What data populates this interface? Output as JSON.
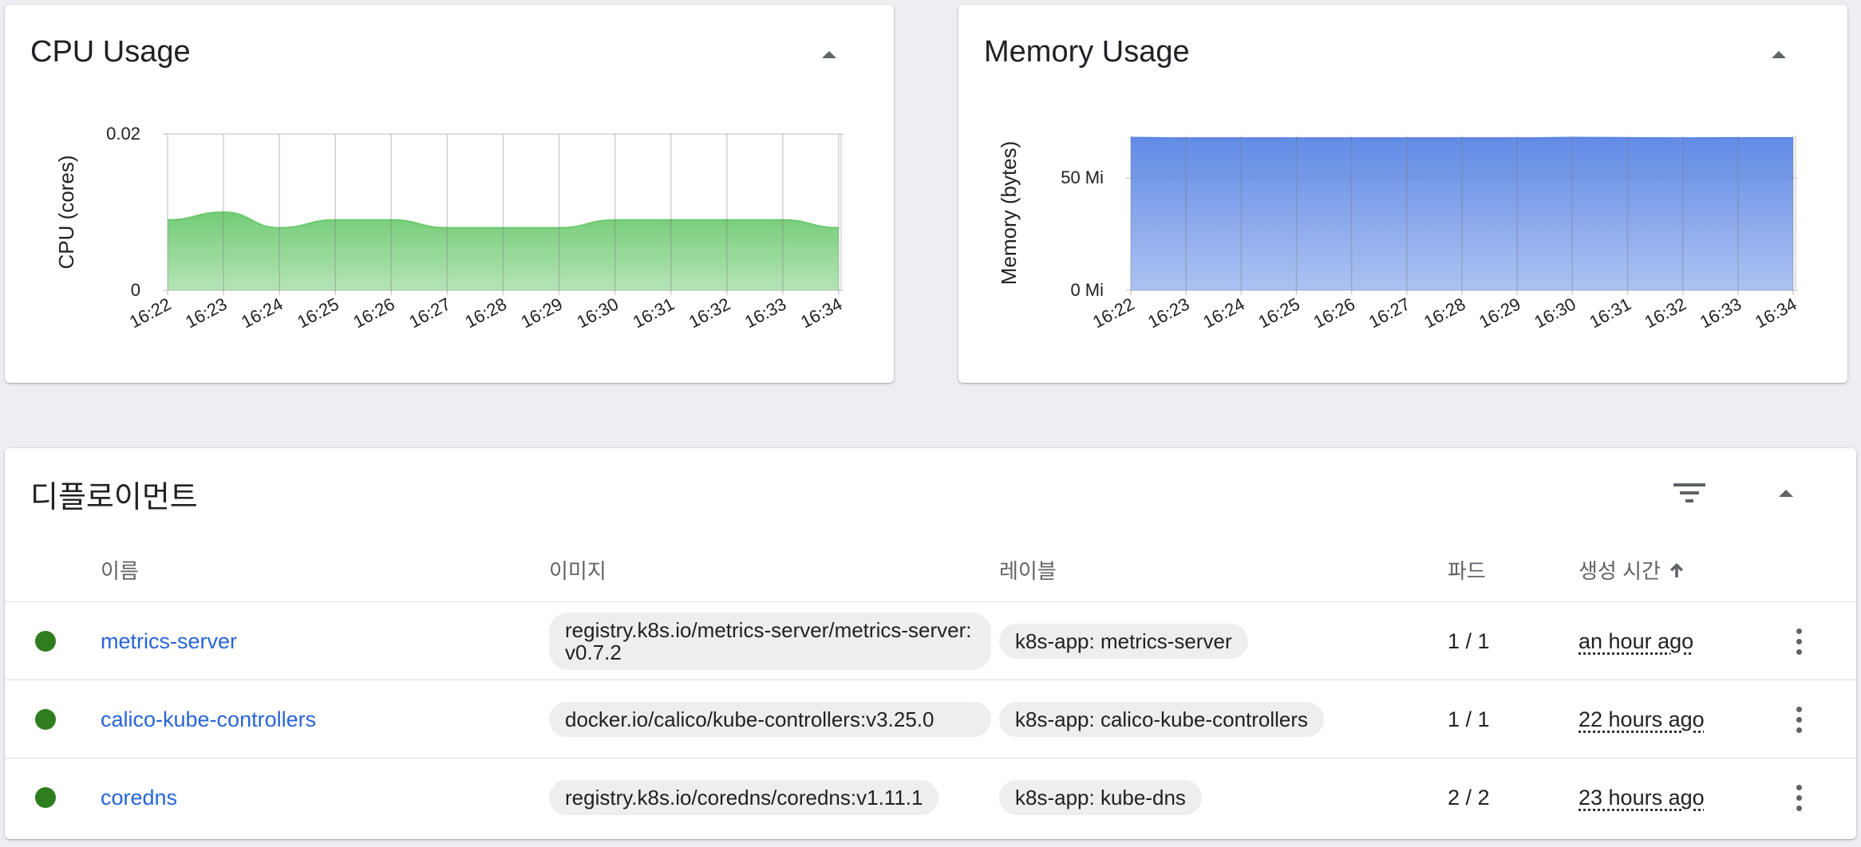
{
  "cpu_card": {
    "title": "CPU Usage"
  },
  "memory_card": {
    "title": "Memory Usage"
  },
  "chart_data": [
    {
      "type": "area",
      "title": "CPU Usage",
      "ylabel": "CPU (cores)",
      "xlabel": "",
      "x": [
        "16:22",
        "16:23",
        "16:24",
        "16:25",
        "16:26",
        "16:27",
        "16:28",
        "16:29",
        "16:30",
        "16:31",
        "16:32",
        "16:33",
        "16:34"
      ],
      "values": [
        0.009,
        0.01,
        0.008,
        0.009,
        0.009,
        0.008,
        0.008,
        0.008,
        0.009,
        0.009,
        0.009,
        0.009,
        0.008
      ],
      "yticks": [
        0,
        0.02
      ],
      "ytick_labels": [
        "0",
        "0.02"
      ],
      "ylim": [
        0,
        0.02
      ],
      "grid": true,
      "color": "#6cc96f"
    },
    {
      "type": "area",
      "title": "Memory Usage",
      "ylabel": "Memory (bytes)",
      "xlabel": "",
      "x": [
        "16:22",
        "16:23",
        "16:24",
        "16:25",
        "16:26",
        "16:27",
        "16:28",
        "16:29",
        "16:30",
        "16:31",
        "16:32",
        "16:33",
        "16:34"
      ],
      "values": [
        68,
        67.8,
        67.8,
        67.8,
        67.8,
        67.8,
        67.8,
        67.8,
        68,
        67.9,
        67.8,
        67.9,
        67.9
      ],
      "value_unit": "Mi",
      "yticks": [
        0,
        50
      ],
      "ytick_labels": [
        "0 Mi",
        "50 Mi"
      ],
      "ylim": [
        0,
        68.9
      ],
      "grid": true,
      "color": "#5a85e4"
    }
  ],
  "deployments": {
    "title": "디플로이먼트",
    "headers": {
      "name": "이름",
      "image": "이미지",
      "labels": "레이블",
      "pods": "파드",
      "created": "생성 시간"
    },
    "rows": [
      {
        "name": "metrics-server",
        "image": "registry.k8s.io/metrics-server/metrics-server:v0.7.2",
        "label": "k8s-app: metrics-server",
        "pods": "1 / 1",
        "age": "an hour ago"
      },
      {
        "name": "calico-kube-controllers",
        "image": "docker.io/calico/kube-controllers:v3.25.0",
        "label": "k8s-app: calico-kube-controllers",
        "pods": "1 / 1",
        "age": "22 hours ago"
      },
      {
        "name": "coredns",
        "image": "registry.k8s.io/coredns/coredns:v1.11.1",
        "label": "k8s-app: kube-dns",
        "pods": "2 / 2",
        "age": "23 hours ago"
      }
    ],
    "status_color": "#2e7d1e",
    "link_color": "#2864d8"
  }
}
